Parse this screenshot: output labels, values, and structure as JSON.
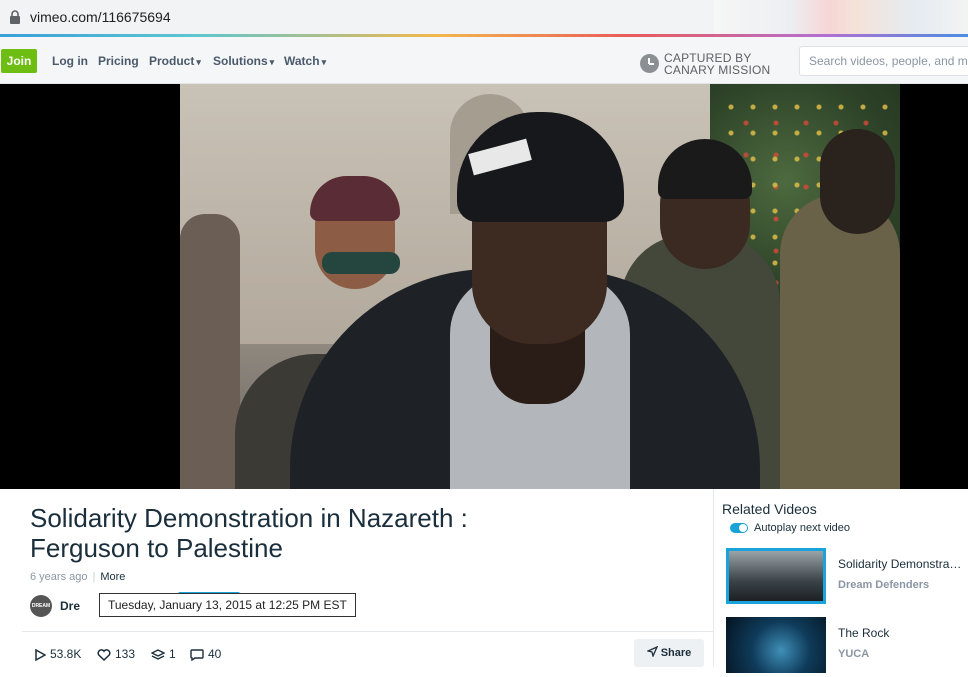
{
  "browser": {
    "url": "vimeo.com/116675694"
  },
  "header": {
    "join_label": "Join",
    "nav": [
      {
        "label": "Log in"
      },
      {
        "label": "Pricing"
      },
      {
        "label": "Product"
      },
      {
        "label": "Solutions"
      },
      {
        "label": "Watch"
      }
    ],
    "captured_line1": "CAPTURED BY",
    "captured_line2": "CANARY MISSION",
    "search_placeholder": "Search videos, people, and more"
  },
  "video": {
    "title_line1": "Solidarity Demonstration in Nazareth :",
    "title_line2": "Ferguson to Palestine",
    "age": "6 years ago",
    "more_label": "More",
    "owner_short": "Dre",
    "avatar_text": "DREAM",
    "tooltip": "Tuesday, January 13, 2015 at 12:25 PM EST",
    "stats": {
      "plays": "53.8K",
      "likes": "133",
      "collections": "1",
      "comments": "40"
    },
    "share_label": "Share"
  },
  "related": {
    "title": "Related Videos",
    "autoplay_label": "Autoplay next video",
    "autoplay_on": true,
    "items": [
      {
        "title": "Solidarity Demonstration in Nazareth",
        "owner": "Dream Defenders"
      },
      {
        "title": "The Rock",
        "owner": "YUCA"
      }
    ]
  },
  "colors": {
    "join": "#6dbd13",
    "accent": "#1aa3d8",
    "text": "#1a2e3b",
    "muted": "#8a96a3"
  }
}
